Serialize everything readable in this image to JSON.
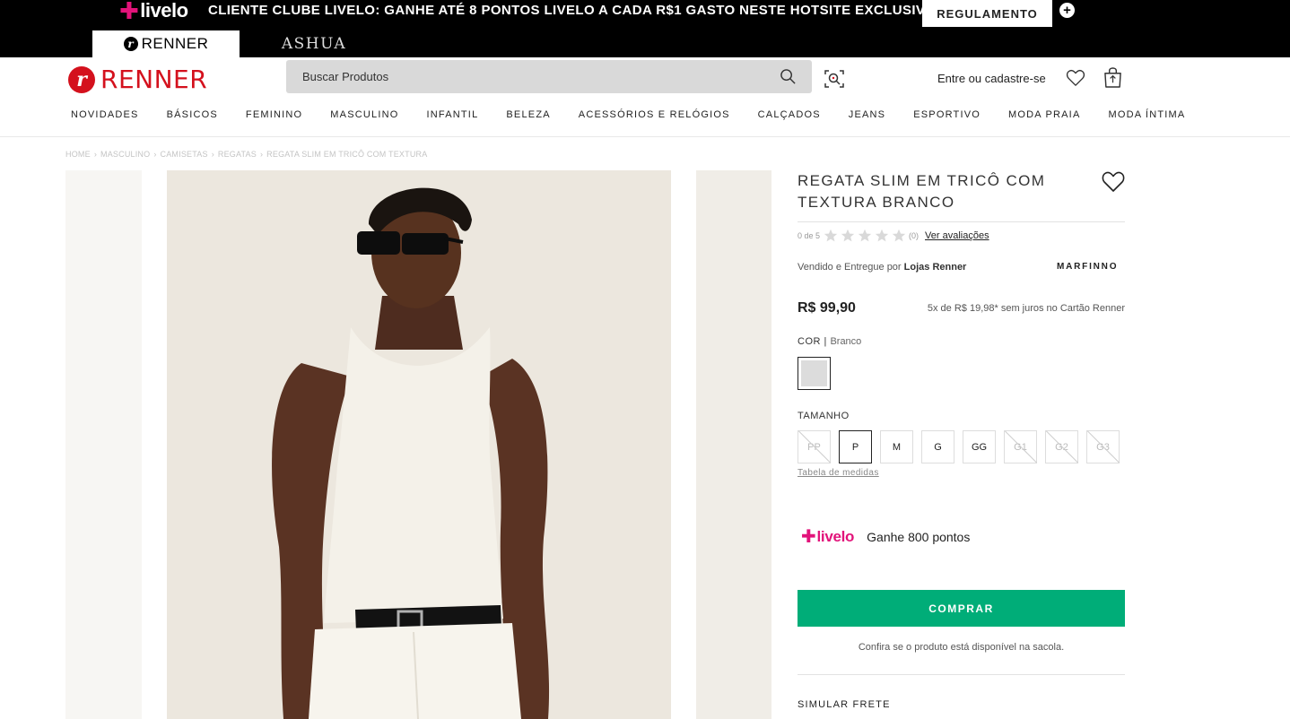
{
  "promo": {
    "livelo_brand": "livelo",
    "text": "CLIENTE CLUBE LIVELO: GANHE ATÉ 8 PONTOS LIVELO A CADA R$1 GASTO NESTE HOTSITE EXCLUSIVO",
    "regulation_label": "REGULAMENTO",
    "expand_icon": "plus-circle-icon"
  },
  "brand_tabs": [
    {
      "label": "RENNER",
      "active": true
    },
    {
      "label": "ASHUA",
      "active": false
    }
  ],
  "header": {
    "logo_text": "RENNER",
    "search_placeholder": "Buscar Produtos",
    "login_label": "Entre ou cadastre-se",
    "brand_color": "#d4111d"
  },
  "nav": [
    "NOVIDADES",
    "BÁSICOS",
    "FEMININO",
    "MASCULINO",
    "INFANTIL",
    "BELEZA",
    "ACESSÓRIOS E RELÓGIOS",
    "CALÇADOS",
    "JEANS",
    "ESPORTIVO",
    "MODA PRAIA",
    "MODA ÍNTIMA"
  ],
  "breadcrumb": [
    "HOME",
    "MASCULINO",
    "CAMISETAS",
    "REGATAS",
    "REGATA SLIM EM TRICÔ COM TEXTURA"
  ],
  "product": {
    "title": "REGATA SLIM EM TRICÔ COM TEXTURA BRANCO",
    "rating_prefix": "0 de 5",
    "rating_value": 0,
    "rating_max": 5,
    "reviews_count": "(0)",
    "reviews_link": "Ver avaliações",
    "seller_prefix": "Vendido e Entregue por",
    "seller_name": "Lojas Renner",
    "brand": "MARFINNO",
    "price": "R$ 99,90",
    "installments": "5x de R$ 19,98* sem juros no Cartão Renner",
    "color_label": "COR",
    "color_selected": "Branco",
    "size_label": "TAMANHO",
    "sizes": [
      {
        "label": "PP",
        "available": false,
        "selected": false
      },
      {
        "label": "P",
        "available": true,
        "selected": true
      },
      {
        "label": "M",
        "available": true,
        "selected": false
      },
      {
        "label": "G",
        "available": true,
        "selected": false
      },
      {
        "label": "GG",
        "available": true,
        "selected": false
      },
      {
        "label": "G1",
        "available": false,
        "selected": false
      },
      {
        "label": "G2",
        "available": false,
        "selected": false
      },
      {
        "label": "G3",
        "available": false,
        "selected": false
      }
    ],
    "size_table_link": "Tabela de medidas",
    "livelo_brand": "livelo",
    "livelo_points": "Ganhe 800 pontos",
    "buy_label": "COMPRAR",
    "availability_note": "Confira se o produto está disponível na sacola.",
    "shipping_label": "SIMULAR FRETE",
    "buy_color": "#00ad78",
    "livelo_color": "#e2137a"
  }
}
